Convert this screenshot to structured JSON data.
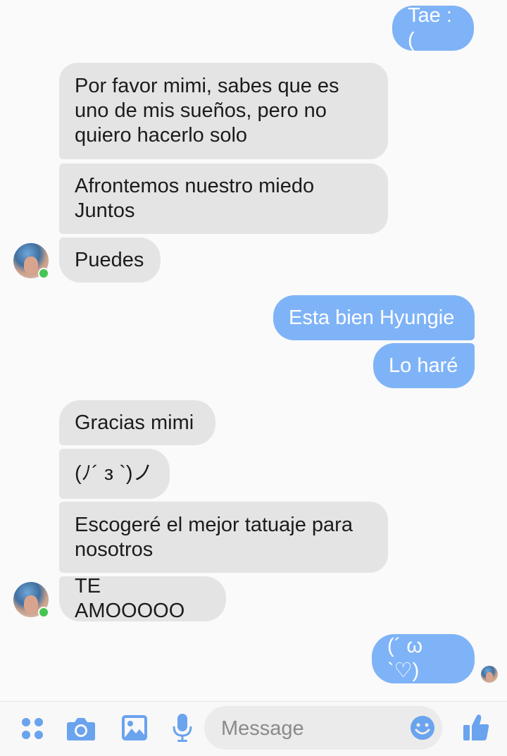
{
  "messages": [
    {
      "id": "m1",
      "from": "me",
      "text": "Tae :("
    },
    {
      "id": "m2",
      "from": "contact",
      "text": "Por favor mimi, sabes que es\nuno de mis sueños, pero no\nquiero hacerlo solo"
    },
    {
      "id": "m3",
      "from": "contact",
      "text": "Afrontemos nuestro miedo\nJuntos"
    },
    {
      "id": "m4",
      "from": "contact",
      "text": "Puedes"
    },
    {
      "id": "m5",
      "from": "me",
      "text": "Esta bien Hyungie"
    },
    {
      "id": "m6",
      "from": "me",
      "text": "Lo haré"
    },
    {
      "id": "m7",
      "from": "contact",
      "text": "Gracias mimi"
    },
    {
      "id": "m8",
      "from": "contact",
      "text": "(ﾉ´ з `)ノ"
    },
    {
      "id": "m9",
      "from": "contact",
      "text": "Escogeré el mejor tatuaje para\nnosotros"
    },
    {
      "id": "m10",
      "from": "contact",
      "text": "TE AMOOOOO"
    },
    {
      "id": "m11",
      "from": "me",
      "text": "(´ ω `♡)"
    }
  ],
  "contact": {
    "avatar": "contact-avatar",
    "status": "online"
  },
  "composer": {
    "placeholder": "Message",
    "icons": [
      "apps-grid-icon",
      "camera-icon",
      "gallery-icon",
      "microphone-icon",
      "emoji-icon",
      "thumbs-up-icon"
    ]
  },
  "colors": {
    "outgoing_bubble": "#7fb3f7",
    "incoming_bubble": "#e4e4e4",
    "accent": "#6aa3ee",
    "online": "#44c553"
  }
}
